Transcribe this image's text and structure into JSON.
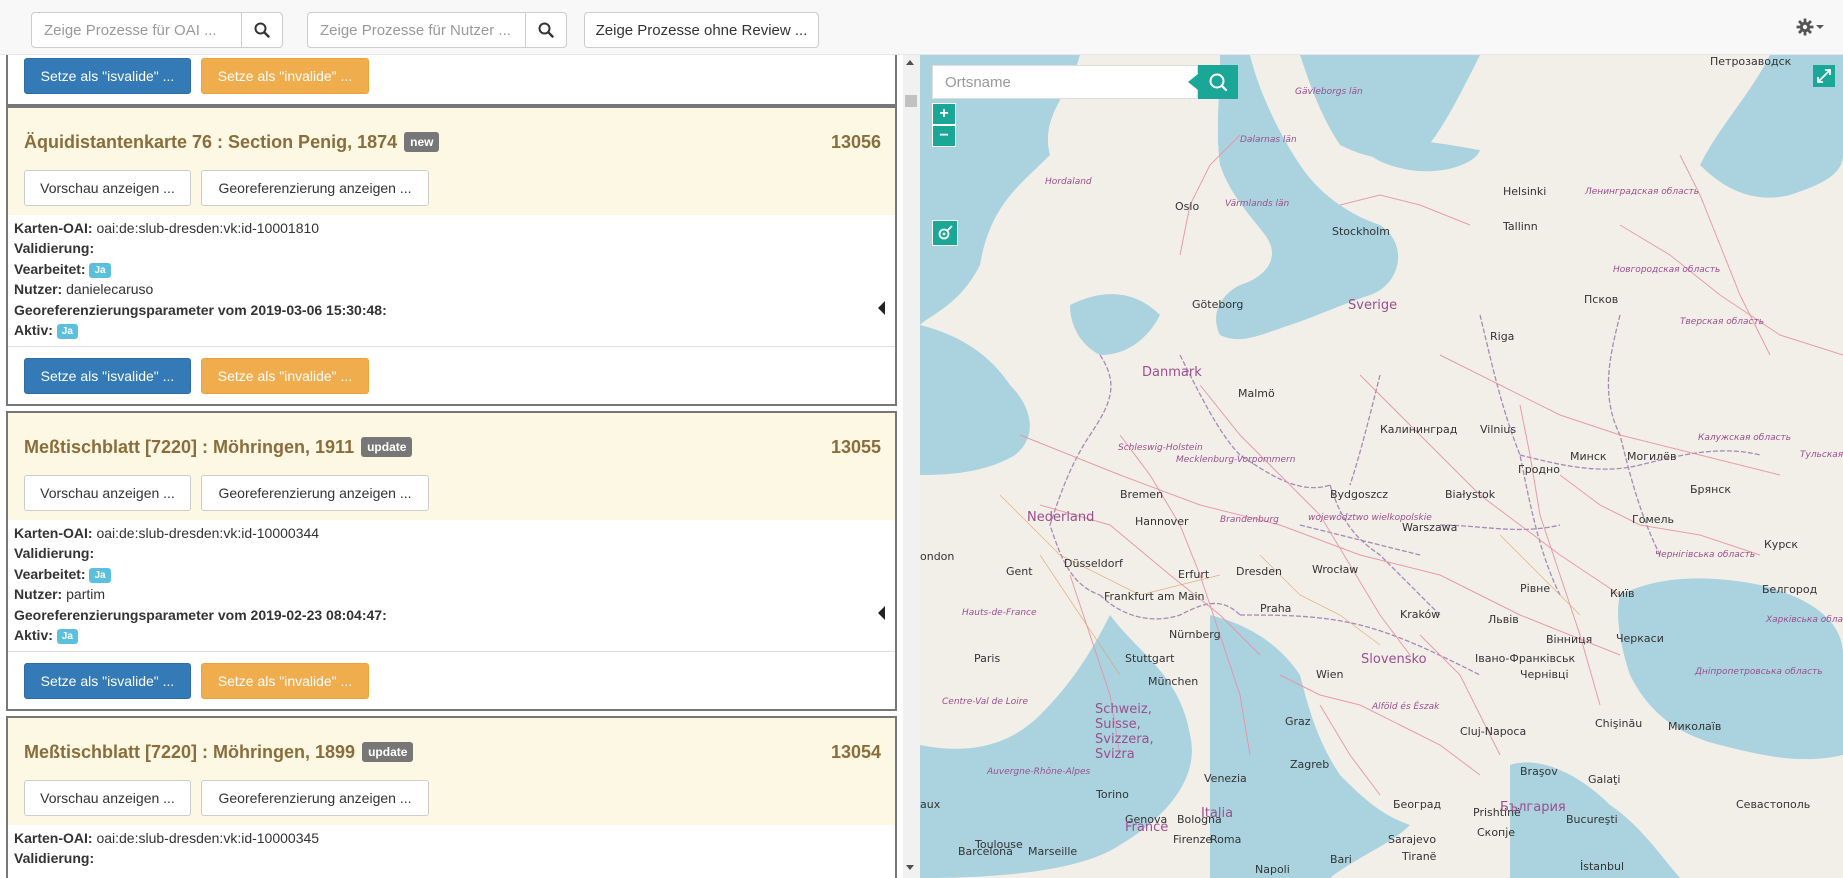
{
  "toolbar": {
    "oai_placeholder": "Zeige Prozesse für OAI ...",
    "user_placeholder": "Zeige Prozesse für Nutzer ...",
    "review_button": "Zeige Prozesse ohne Review ..."
  },
  "labels": {
    "karten_oai": "Karten-OAI:",
    "validierung": "Validierung:",
    "vearbeitet": "Vearbeitet:",
    "nutzer": "Nutzer:",
    "aktiv": "Aktiv:",
    "vorschau": "Vorschau anzeigen ...",
    "georef": "Georeferenzierung anzeigen ...",
    "set_valid": "Setze als \"isvalide\" ...",
    "set_invalid": "Setze als \"invalide\" ..."
  },
  "cards": [
    {
      "title": "Äquidistantenkarte 76 : Section Penig, 1874",
      "badge": "new",
      "id": "13056",
      "oai": "oai:de:slub-dresden:vk:id-10001810",
      "vearbeitet": "Ja",
      "nutzer": "danielecaruso",
      "params": "Georeferenzierungsparameter vom 2019-03-06 15:30:48:",
      "aktiv": "Ja"
    },
    {
      "title": "Meßtischblatt [7220] : Möhringen, 1911",
      "badge": "update",
      "id": "13055",
      "oai": "oai:de:slub-dresden:vk:id-10000344",
      "vearbeitet": "Ja",
      "nutzer": "partim",
      "params": "Georeferenzierungsparameter vom 2019-02-23 08:04:47:",
      "aktiv": "Ja"
    },
    {
      "title": "Meßtischblatt [7220] : Möhringen, 1899",
      "badge": "update",
      "id": "13054",
      "oai": "oai:de:slub-dresden:vk:id-10000345"
    }
  ],
  "map": {
    "search_placeholder": "Ortsname",
    "zoom_in": "+",
    "zoom_out": "−",
    "labels": [
      {
        "text": "Петрозаводск",
        "cls": ""
      },
      {
        "text": "Gävleborgs län",
        "cls": "region"
      },
      {
        "text": "Dalarnas län",
        "cls": "region"
      },
      {
        "text": "Hordaland",
        "cls": "region"
      },
      {
        "text": "Oslo",
        "cls": ""
      },
      {
        "text": "Värmlands län",
        "cls": "region"
      },
      {
        "text": "Helsinki",
        "cls": ""
      },
      {
        "text": "Ленинградская область",
        "cls": "region"
      },
      {
        "text": "Stockholm",
        "cls": ""
      },
      {
        "text": "Tallinn",
        "cls": ""
      },
      {
        "text": "Новгородская область",
        "cls": "region"
      },
      {
        "text": "Göteborg",
        "cls": ""
      },
      {
        "text": "Sverige",
        "cls": "country"
      },
      {
        "text": "Псков",
        "cls": ""
      },
      {
        "text": "Тверская область",
        "cls": "region"
      },
      {
        "text": "Riga",
        "cls": ""
      },
      {
        "text": "Danmark",
        "cls": "country"
      },
      {
        "text": "Malmö",
        "cls": ""
      },
      {
        "text": "Schleswig-Holstein",
        "cls": "region"
      },
      {
        "text": "Калининград",
        "cls": ""
      },
      {
        "text": "Vilnius",
        "cls": ""
      },
      {
        "text": "Калужская область",
        "cls": "region"
      },
      {
        "text": "Mecklenburg-Vorpommern",
        "cls": "region"
      },
      {
        "text": "Минск",
        "cls": ""
      },
      {
        "text": "Могилёв",
        "cls": ""
      },
      {
        "text": "Тульская области",
        "cls": "region"
      },
      {
        "text": "Гродно",
        "cls": ""
      },
      {
        "text": "Bremen",
        "cls": ""
      },
      {
        "text": "Bydgoszcz",
        "cls": ""
      },
      {
        "text": "Białystok",
        "cls": ""
      },
      {
        "text": "Брянск",
        "cls": ""
      },
      {
        "text": "Nederland",
        "cls": "country"
      },
      {
        "text": "Hannover",
        "cls": ""
      },
      {
        "text": "Brandenburg",
        "cls": "region"
      },
      {
        "text": "województwo wielkopolskie",
        "cls": "region"
      },
      {
        "text": "Warszawa",
        "cls": ""
      },
      {
        "text": "Гомель",
        "cls": ""
      },
      {
        "text": "ondon",
        "cls": ""
      },
      {
        "text": "Gent",
        "cls": ""
      },
      {
        "text": "Düsseldorf",
        "cls": ""
      },
      {
        "text": "Erfurt",
        "cls": ""
      },
      {
        "text": "Dresden",
        "cls": ""
      },
      {
        "text": "Wrocław",
        "cls": ""
      },
      {
        "text": "Курск",
        "cls": ""
      },
      {
        "text": "Чернігівська область",
        "cls": "region"
      },
      {
        "text": "Frankfurt am Main",
        "cls": ""
      },
      {
        "text": "Praha",
        "cls": ""
      },
      {
        "text": "Рівне",
        "cls": ""
      },
      {
        "text": "Київ",
        "cls": ""
      },
      {
        "text": "Белгород",
        "cls": ""
      },
      {
        "text": "Hauts-de-France",
        "cls": "region"
      },
      {
        "text": "Kraków",
        "cls": ""
      },
      {
        "text": "Львів",
        "cls": ""
      },
      {
        "text": "Харківська область",
        "cls": "region"
      },
      {
        "text": "Nürnberg",
        "cls": ""
      },
      {
        "text": "Вінниця",
        "cls": ""
      },
      {
        "text": "Черкаси",
        "cls": ""
      },
      {
        "text": "Paris",
        "cls": ""
      },
      {
        "text": "Stuttgart",
        "cls": ""
      },
      {
        "text": "Slovensko",
        "cls": "country"
      },
      {
        "text": "Івано-Франківськ",
        "cls": ""
      },
      {
        "text": "Дніпропетровська область",
        "cls": "region"
      },
      {
        "text": "München",
        "cls": ""
      },
      {
        "text": "Wien",
        "cls": ""
      },
      {
        "text": "Чернівці",
        "cls": ""
      },
      {
        "text": "Centre-Val de Loire",
        "cls": "region"
      },
      {
        "text": "Schweiz, Suisse, Svizzera, Svizra",
        "cls": "country"
      },
      {
        "text": "Alföld és Észak",
        "cls": "region"
      },
      {
        "text": "Graz",
        "cls": ""
      },
      {
        "text": "Cluj-Napoca",
        "cls": ""
      },
      {
        "text": "Chişinău",
        "cls": ""
      },
      {
        "text": "Миколаїв",
        "cls": ""
      },
      {
        "text": "Zagreb",
        "cls": ""
      },
      {
        "text": "Auvergne-Rhône-Alpes",
        "cls": "region"
      },
      {
        "text": "Venezia",
        "cls": ""
      },
      {
        "text": "Braşov",
        "cls": ""
      },
      {
        "text": "Galaţi",
        "cls": ""
      },
      {
        "text": "Torino",
        "cls": ""
      },
      {
        "text": "aux",
        "cls": ""
      },
      {
        "text": "Београд",
        "cls": ""
      },
      {
        "text": "Севастополь",
        "cls": ""
      },
      {
        "text": "Genova",
        "cls": ""
      },
      {
        "text": "Bologna",
        "cls": ""
      },
      {
        "text": "Bucureşti",
        "cls": ""
      },
      {
        "text": "Toulouse",
        "cls": ""
      },
      {
        "text": "Firenze",
        "cls": ""
      },
      {
        "text": "Sarajevo",
        "cls": ""
      },
      {
        "text": "Marseille",
        "cls": ""
      },
      {
        "text": "Italia",
        "cls": "country"
      },
      {
        "text": "Prishtinë",
        "cls": ""
      },
      {
        "text": "България",
        "cls": "country"
      },
      {
        "text": "France",
        "cls": "country"
      },
      {
        "text": "Скопје",
        "cls": ""
      },
      {
        "text": "Roma",
        "cls": ""
      },
      {
        "text": "Barcelona",
        "cls": ""
      },
      {
        "text": "Bari",
        "cls": ""
      },
      {
        "text": "Tiranë",
        "cls": ""
      },
      {
        "text": "Napoli",
        "cls": ""
      },
      {
        "text": "İstanbul",
        "cls": ""
      }
    ]
  }
}
